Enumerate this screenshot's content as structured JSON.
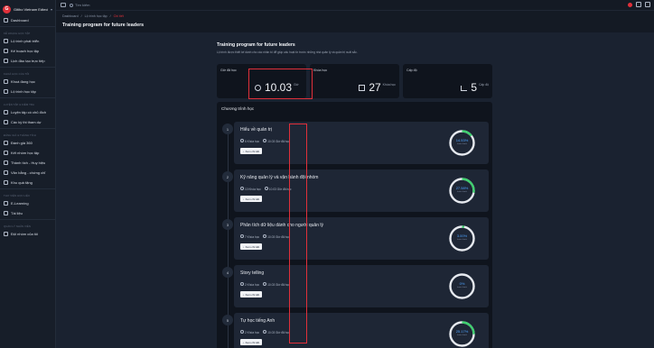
{
  "brand": {
    "name": "Gitiho Vietnam Edtech C...",
    "logo_letter": "G"
  },
  "sidebar": {
    "items": [
      {
        "label": "Dashboard",
        "section": ""
      },
      {
        "label": "Lộ trình phát triển",
        "section": "KẾ HOẠCH HỌC TẬP"
      },
      {
        "label": "Kế hoạch học tập",
        "section": ""
      },
      {
        "label": "Lịch đào tạo trực tiếp",
        "section": ""
      },
      {
        "label": "Khoá đang học",
        "section": "KHOÁ HỌC CỦA TÔI"
      },
      {
        "label": "Lộ trình học tập",
        "section": ""
      },
      {
        "label": "Luyện tập có chủ đích",
        "section": "LUYỆN TẬP & KIỂM TRA"
      },
      {
        "label": "Các kỳ thi tham dự",
        "section": ""
      },
      {
        "label": "Đánh giá 360",
        "section": "ĐÁNH GIÁ & THÀNH TÍCH"
      },
      {
        "label": "Kết nhóm học tập",
        "section": ""
      },
      {
        "label": "Thành tích - Huy hiệu",
        "section": ""
      },
      {
        "label": "Văn bằng - chứng chỉ",
        "section": ""
      },
      {
        "label": "Khu quà tặng",
        "section": ""
      },
      {
        "label": "E-Learning",
        "section": "THƯ VIỆN HỌC LIỆU"
      },
      {
        "label": "Tài liệu",
        "section": ""
      },
      {
        "label": "Đội nhóm của tôi",
        "section": "QUẢN LÝ NHÂN VIÊN"
      }
    ]
  },
  "topbar": {
    "search_placeholder": "Tìm kiếm"
  },
  "breadcrumb": [
    "Dashboard",
    "Lộ trình học tập",
    "Chi tiết"
  ],
  "page_title": "Training program for future leaders",
  "program": {
    "title": "Training program for future leaders",
    "description": "Lộ trình được thiết kế dành cho các nhân tố để giúp cấu hoạt từ trước những nhà quản lý và quản trị xuất sắc."
  },
  "stats": [
    {
      "label": "Giờ đã học",
      "value": "10.03",
      "unit": "Giờ",
      "icon": "clock-icon"
    },
    {
      "label": "Khóa học",
      "value": "27",
      "unit": "Khóa học",
      "icon": "grid-icon"
    },
    {
      "label": "Cấp độ",
      "value": "5",
      "unit": "Cấp độ",
      "icon": "chart-icon"
    }
  ],
  "curriculum": {
    "title": "Chương trình học",
    "view_label": "Xem chi tiết",
    "progress_sub": "hoàn thành",
    "courses": [
      {
        "step": "1",
        "name": "Hiểu về quản trị",
        "count": "6 Khóa học",
        "hours": "10.03 Giờ đã học",
        "progress": "14.53%",
        "fraction": 0.1453
      },
      {
        "step": "2",
        "name": "Kỹ năng quản lý và vận hành đội nhóm",
        "count": "10 Khóa học",
        "hours": "10.03 Giờ đã học",
        "progress": "27.58%",
        "fraction": 0.2758
      },
      {
        "step": "3",
        "name": "Phân tích dữ liệu dành cho người quản lý",
        "count": "7 Khóa học",
        "hours": "10.03 Giờ đã học",
        "progress": "3.00%",
        "fraction": 0.03
      },
      {
        "step": "4",
        "name": "Story telling",
        "count": "2 Khóa học",
        "hours": "10.03 Giờ đã học",
        "progress": "0%",
        "fraction": 0
      },
      {
        "step": "5",
        "name": "Tự học tiếng Anh",
        "count": "2 Khóa học",
        "hours": "10.03 Giờ đã học",
        "progress": "25.17%",
        "fraction": 0.2517
      }
    ]
  },
  "colors": {
    "accent": "#e0303a",
    "progress": "#4ea3ff",
    "ring_done": "#3ecf6e",
    "ring_track": "#e6e9ef"
  }
}
